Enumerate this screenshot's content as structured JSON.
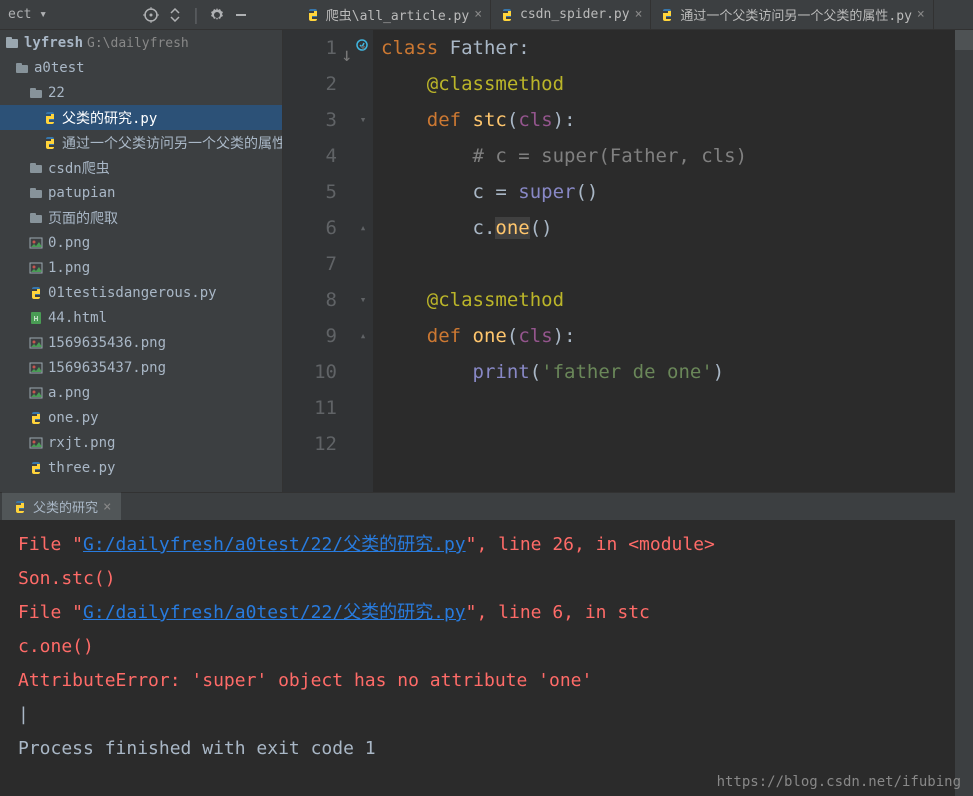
{
  "topbar": {
    "project_dd": "ect ▾"
  },
  "tabs": [
    {
      "label": "爬虫\\all_article.py",
      "active": false
    },
    {
      "label": "csdn_spider.py",
      "active": false
    },
    {
      "label": "通过一个父类访问另一个父类的属性.py",
      "active": false
    }
  ],
  "tree": {
    "root_name": "lyfresh",
    "root_path": "G:\\dailyfresh",
    "items": [
      {
        "indent": 1,
        "icon": "folder",
        "label": "a0test"
      },
      {
        "indent": 2,
        "icon": "folder",
        "label": "22"
      },
      {
        "indent": 3,
        "icon": "py",
        "label": "父类的研究.py",
        "selected": true
      },
      {
        "indent": 3,
        "icon": "py",
        "label": "通过一个父类访问另一个父类的属性.p"
      },
      {
        "indent": 2,
        "icon": "folder",
        "label": "csdn爬虫"
      },
      {
        "indent": 2,
        "icon": "folder",
        "label": "patupian"
      },
      {
        "indent": 2,
        "icon": "folder",
        "label": "页面的爬取"
      },
      {
        "indent": 2,
        "icon": "img",
        "label": "0.png"
      },
      {
        "indent": 2,
        "icon": "img",
        "label": "1.png"
      },
      {
        "indent": 2,
        "icon": "py",
        "label": "01testisdangerous.py"
      },
      {
        "indent": 2,
        "icon": "html",
        "label": "44.html"
      },
      {
        "indent": 2,
        "icon": "img",
        "label": "1569635436.png"
      },
      {
        "indent": 2,
        "icon": "img",
        "label": "1569635437.png"
      },
      {
        "indent": 2,
        "icon": "img",
        "label": "a.png"
      },
      {
        "indent": 2,
        "icon": "py",
        "label": "one.py"
      },
      {
        "indent": 2,
        "icon": "img",
        "label": "rxjt.png"
      },
      {
        "indent": 2,
        "icon": "py",
        "label": "three.py"
      }
    ]
  },
  "code_lines": [
    "1",
    "2",
    "3",
    "4",
    "5",
    "6",
    "7",
    "8",
    "9",
    "10",
    "11",
    "12"
  ],
  "code": {
    "l1": {
      "kw": "class ",
      "id": "Father:"
    },
    "l2": {
      "dec": "@classmethod"
    },
    "l3": {
      "kw": "def ",
      "fn": "stc",
      "p1": "(",
      "self": "cls",
      "p2": "):"
    },
    "l4": {
      "com": "# c = super(Father, cls)"
    },
    "l5": {
      "id": "c = ",
      "bi": "super",
      "p": "()"
    },
    "l6": {
      "id": "c.",
      "fn": "one",
      "p": "()"
    },
    "l8": {
      "dec": "@classmethod"
    },
    "l9": {
      "kw": "def ",
      "fn": "one",
      "p1": "(",
      "self": "cls",
      "p2": "):"
    },
    "l10": {
      "bi": "print",
      "p1": "(",
      "str": "'father de one'",
      "p2": ")"
    }
  },
  "run_tab": {
    "label": "父类的研究"
  },
  "console": {
    "l1a": "  File \"",
    "l1link": "G:/dailyfresh/a0test/22/父类的研究.py",
    "l1b": "\", line 26, in <module>",
    "l2": "    Son.stc()",
    "l3a": "  File \"",
    "l3link": "G:/dailyfresh/a0test/22/父类的研究.py",
    "l3b": "\", line 6, in stc",
    "l4": "    c.one()",
    "l5": "AttributeError: 'super' object has no attribute 'one'",
    "cursor": "|",
    "exit": "Process finished with exit code 1"
  },
  "watermark": "https://blog.csdn.net/ifubing"
}
